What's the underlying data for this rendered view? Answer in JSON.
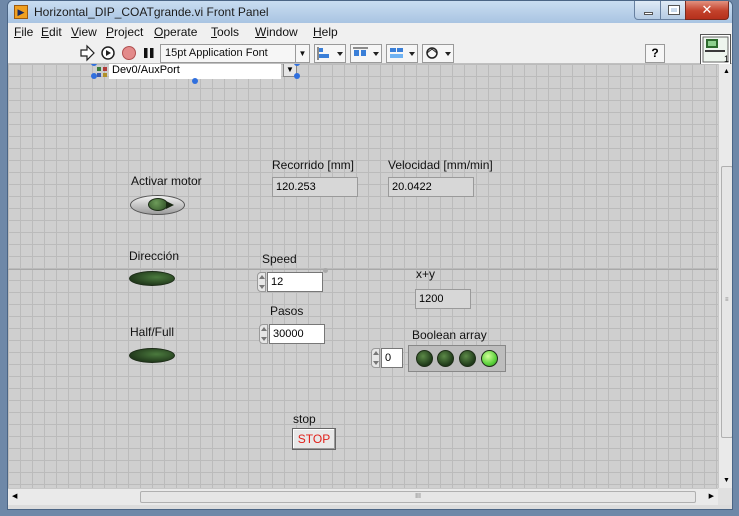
{
  "window": {
    "title": "Horizontal_DIP_COATgrande.vi Front Panel",
    "close_glyph": "✕"
  },
  "menubar": {
    "items": [
      {
        "key": "F",
        "rest": "ile"
      },
      {
        "key": "E",
        "rest": "dit"
      },
      {
        "key": "V",
        "rest": "iew"
      },
      {
        "key": "P",
        "rest": "roject"
      },
      {
        "key": "O",
        "rest": "perate"
      },
      {
        "key": "T",
        "rest": "ools"
      },
      {
        "key": "W",
        "rest": "indow"
      },
      {
        "key": "H",
        "rest": "elp"
      }
    ]
  },
  "toolbar": {
    "font_ring": "15pt Application Font",
    "icons": [
      "run-arrow-icon",
      "run-continuously-icon",
      "abort-icon",
      "pause-icon",
      "align-icon",
      "distribute-icon",
      "resize-icon",
      "reorder-icon",
      "help-icon",
      "vi-connector-icon"
    ],
    "help_glyph": "?",
    "connector_badge": "1"
  },
  "panel": {
    "resource": {
      "value": "Dev0/AuxPort"
    },
    "activar_motor": {
      "label": "Activar motor"
    },
    "recorrido": {
      "label": "Recorrido [mm]",
      "value": "120.253"
    },
    "velocidad": {
      "label": "Velocidad [mm/min]",
      "value": "20.0422"
    },
    "direccion": {
      "label": "Dirección"
    },
    "speed": {
      "label": "Speed",
      "value": "12"
    },
    "xy": {
      "label": "x+y",
      "value": "1200"
    },
    "pasos": {
      "label": "Pasos",
      "value": "30000"
    },
    "half_full": {
      "label": "Half/Full"
    },
    "boolean_array": {
      "label": "Boolean array",
      "index": "0",
      "leds": [
        false,
        false,
        false,
        true
      ]
    },
    "stop": {
      "label": "stop",
      "button_text": "STOP"
    }
  },
  "scrollbar": {
    "h_grip": "III"
  },
  "colors": {
    "led_on": "#5ad13a",
    "led_off": "#2e4a26",
    "stop_text": "#e0201a",
    "panel_bg": "#cfcfcf"
  }
}
